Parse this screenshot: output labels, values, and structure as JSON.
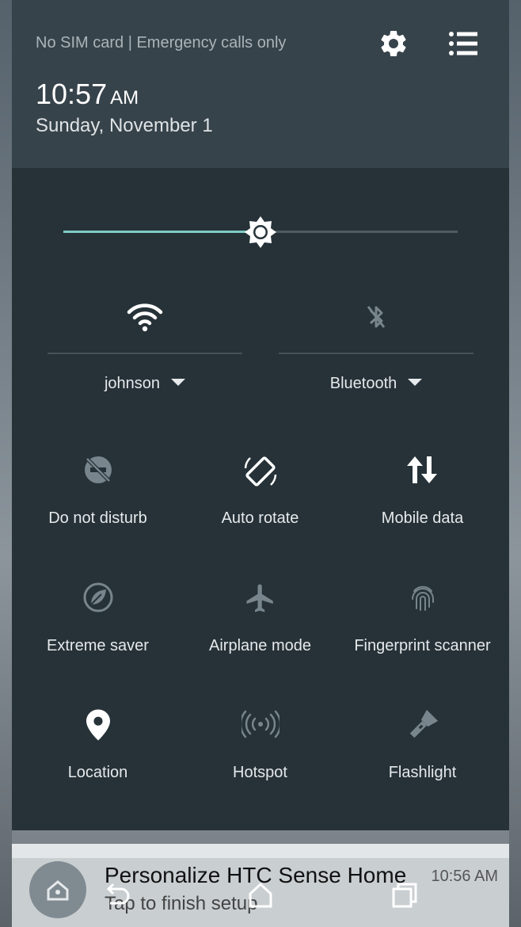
{
  "status": {
    "carrier_text": "No SIM card | Emergency calls only",
    "time": "10:57",
    "ampm": "AM",
    "date": "Sunday, November 1"
  },
  "header_icons": [
    "settings-gear-icon",
    "list-menu-icon"
  ],
  "brightness": {
    "level_fraction": 0.5
  },
  "wide_tiles": [
    {
      "label": "johnson",
      "icon": "wifi-icon",
      "active": true
    },
    {
      "label": "Bluetooth",
      "icon": "bluetooth-off-icon",
      "active": false
    }
  ],
  "tiles": [
    {
      "label": "Do not disturb",
      "icon": "do-not-disturb-icon",
      "active": false
    },
    {
      "label": "Auto rotate",
      "icon": "auto-rotate-icon",
      "active": true
    },
    {
      "label": "Mobile data",
      "icon": "mobile-data-icon",
      "active": true
    },
    {
      "label": "Extreme saver",
      "icon": "extreme-saver-leaf-icon",
      "active": false
    },
    {
      "label": "Airplane mode",
      "icon": "airplane-icon",
      "active": false
    },
    {
      "label": "Fingerprint scanner",
      "icon": "fingerprint-icon",
      "active": false
    },
    {
      "label": "Location",
      "icon": "location-pin-icon",
      "active": true
    },
    {
      "label": "Hotspot",
      "icon": "hotspot-icon",
      "active": false
    },
    {
      "label": "Flashlight",
      "icon": "flashlight-icon",
      "active": false
    }
  ],
  "notification": {
    "title": "Personalize HTC Sense Home",
    "subtitle": "Tap to finish setup",
    "time": "10:56 AM"
  },
  "colors": {
    "shade_bg": "#263238",
    "header_bg": "#37434b",
    "accent": "#7fcbc4",
    "icon_active": "#ffffff",
    "icon_inactive": "#78858c"
  }
}
